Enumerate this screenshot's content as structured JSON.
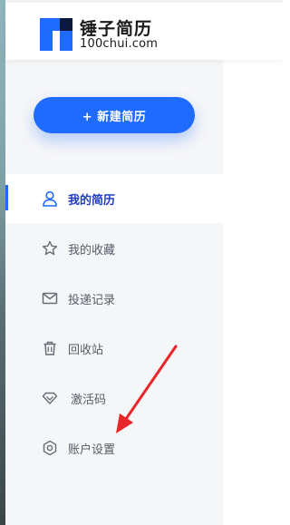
{
  "header": {
    "brand_name": "锤子简历",
    "brand_domain": "100chui.com"
  },
  "sidebar": {
    "new_button_label": "+ 新建简历",
    "items": [
      {
        "label": "我的简历",
        "icon": "user-icon",
        "active": true
      },
      {
        "label": "我的收藏",
        "icon": "star-icon",
        "active": false
      },
      {
        "label": "投递记录",
        "icon": "mail-icon",
        "active": false
      },
      {
        "label": "回收站",
        "icon": "trash-icon",
        "active": false
      },
      {
        "label": "激活码",
        "icon": "diamond-icon",
        "active": false
      },
      {
        "label": "账户设置",
        "icon": "gear-icon",
        "active": false
      }
    ]
  },
  "colors": {
    "accent": "#1f6bff",
    "active_text": "#1f3cc8",
    "sidebar_bg": "#f5f6f8",
    "annotation_arrow": "#e8262a"
  }
}
